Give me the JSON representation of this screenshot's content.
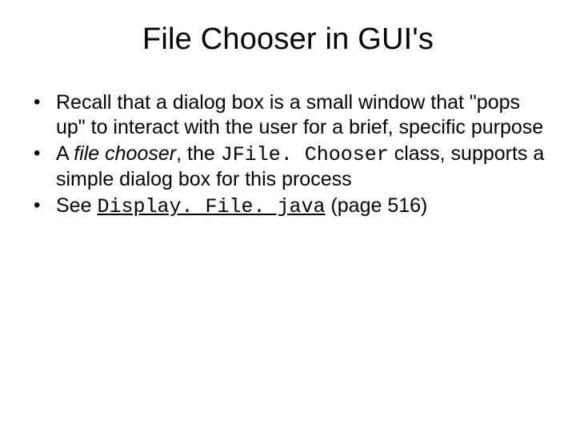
{
  "slide_title": "File Chooser in GUI's",
  "bullet1": "Recall that a dialog box is a small window that \"pops up\" to interact with the user for a brief, specific purpose",
  "bullet2": {
    "lead": "A ",
    "italic": "file chooser",
    "mid": ", the ",
    "classname": "JFile. Chooser",
    "tail": " class, supports a simple dialog box for this process"
  },
  "bullet3": {
    "lead": "See ",
    "link": "Display. File. java",
    "tail": " (page 516)"
  }
}
